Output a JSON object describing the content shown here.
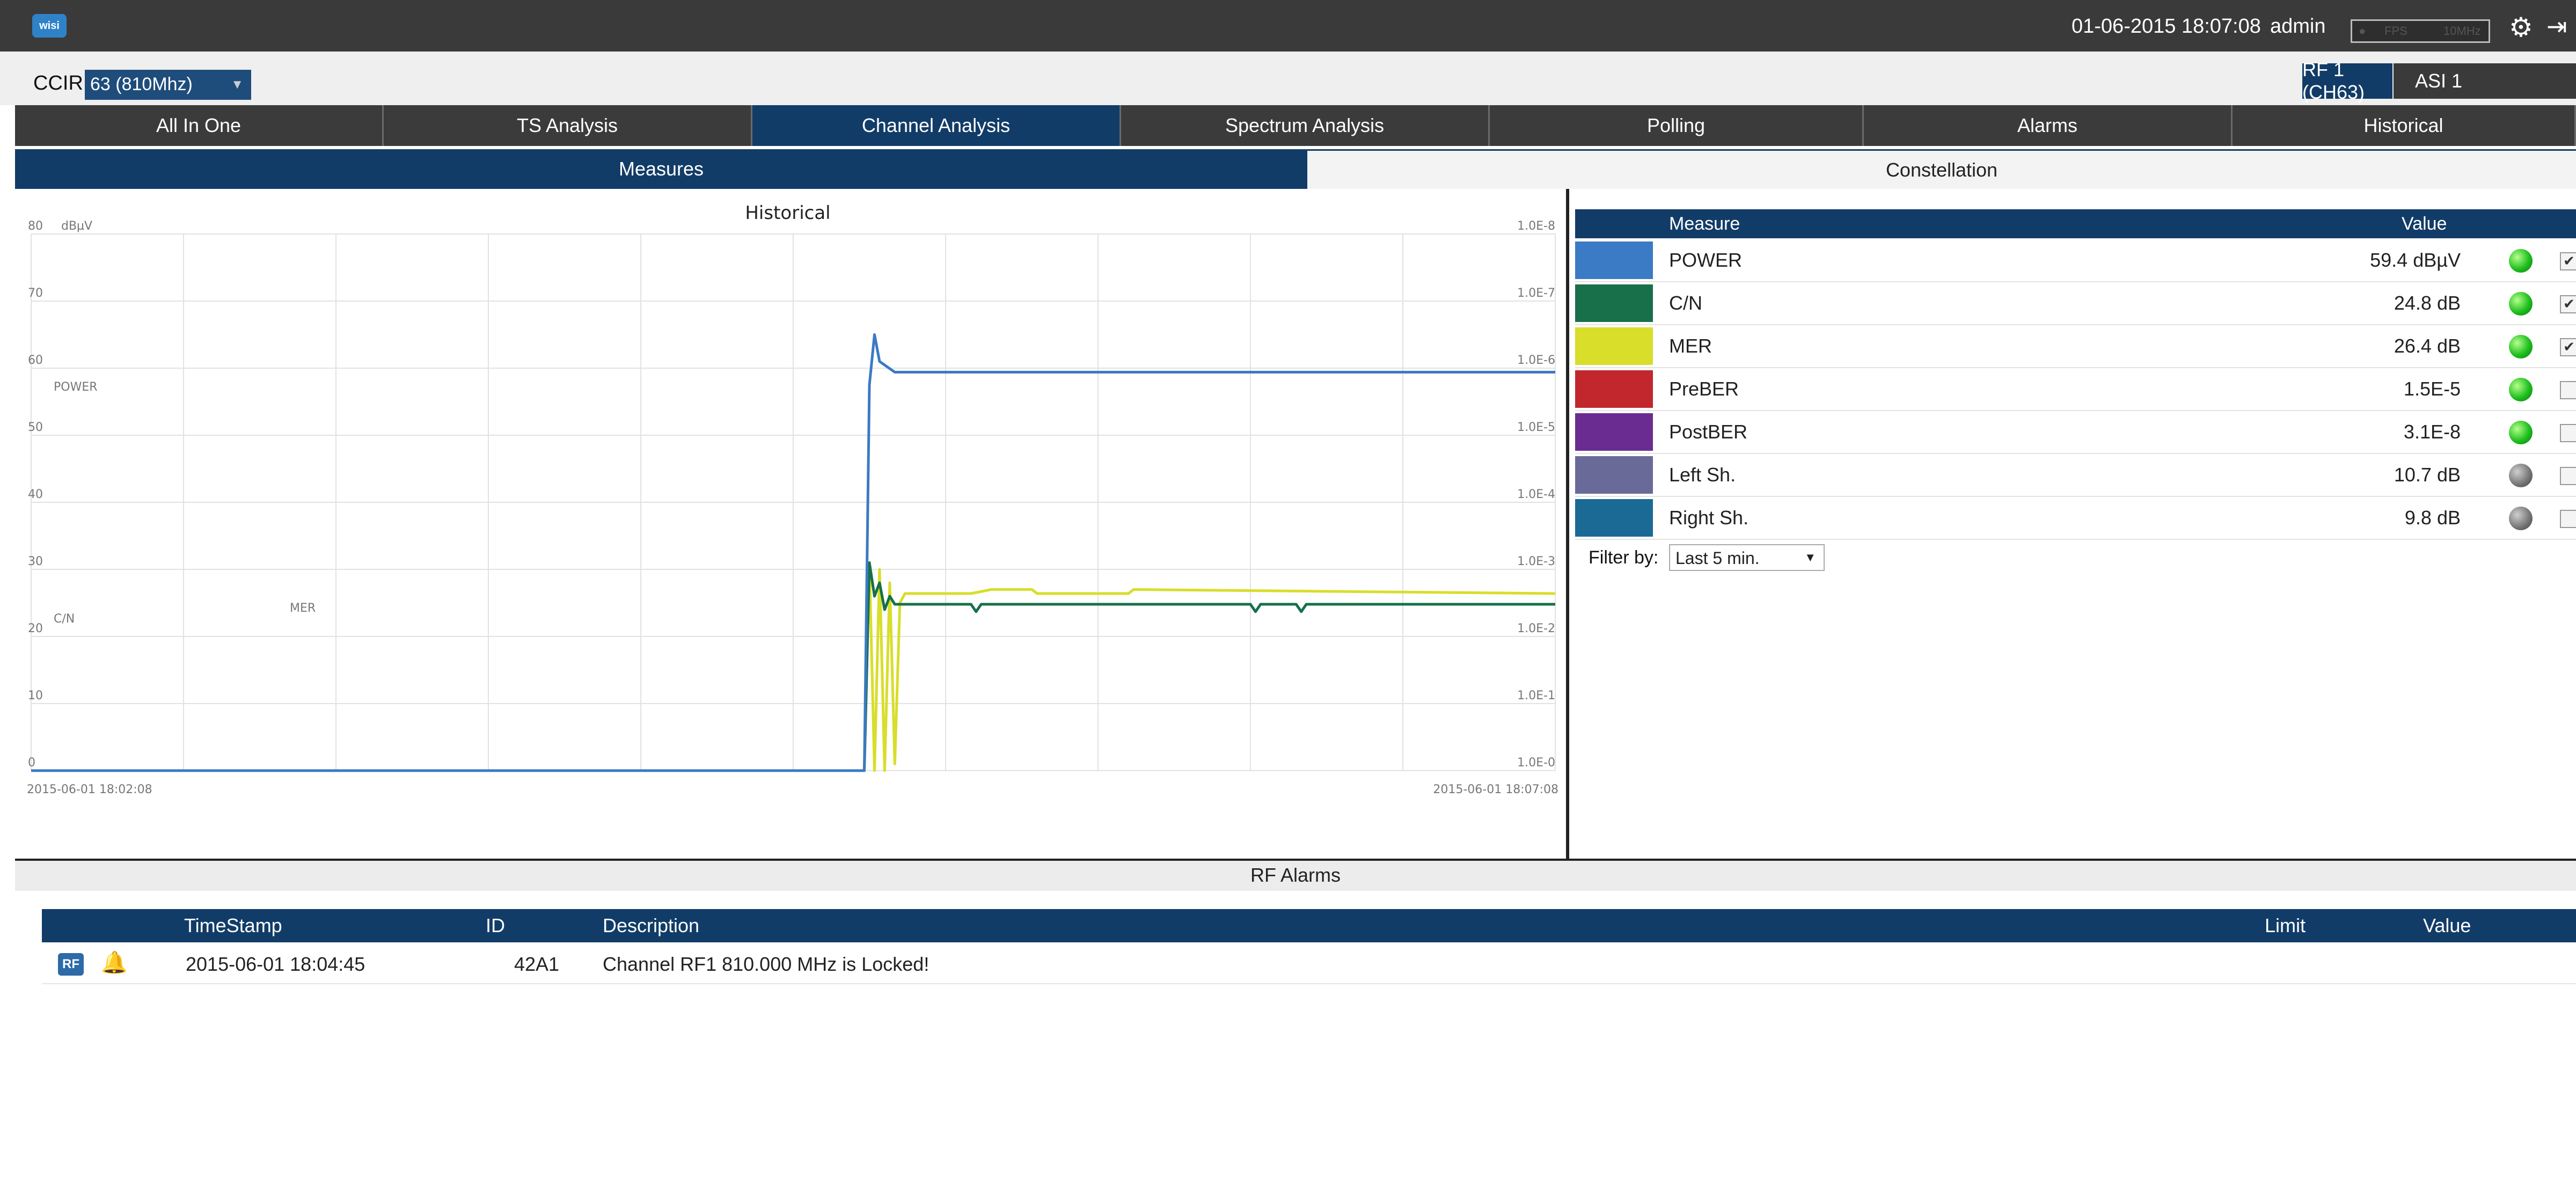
{
  "header": {
    "logo_text": "wisi",
    "datetime": "01-06-2015 18:07:08",
    "user": "admin",
    "meter_left": "FPS",
    "meter_right": "10MHz"
  },
  "subbar": {
    "ccir_label": "CCIR",
    "ccir_value": "63 (810Mhz)",
    "rf_badge": "RF 1 (CH63)",
    "asi_badge": "ASI 1"
  },
  "nav_tabs": [
    {
      "label": "All In One"
    },
    {
      "label": "TS Analysis"
    },
    {
      "label": "Channel Analysis",
      "active": true
    },
    {
      "label": "Spectrum Analysis"
    },
    {
      "label": "Polling"
    },
    {
      "label": "Alarms"
    },
    {
      "label": "Historical"
    }
  ],
  "sub_tabs": [
    {
      "label": "Measures",
      "active": true
    },
    {
      "label": "Constellation"
    }
  ],
  "chart_data": {
    "type": "line",
    "title": "Historical",
    "ylabel": "dBµV",
    "ylim": [
      0,
      80
    ],
    "y_ticks": [
      "80",
      "70",
      "60",
      "50",
      "40",
      "30",
      "20",
      "10",
      "0"
    ],
    "y2_ticks": [
      "1.0E-8",
      "1.0E-7",
      "1.0E-6",
      "1.0E-5",
      "1.0E-4",
      "1.0E-3",
      "1.0E-2",
      "1.0E-1",
      "1.0E-0"
    ],
    "x_start_label": "2015-06-01 18:02:08",
    "x_end_label": "2015-06-01 18:07:08",
    "xlim": [
      0,
      300
    ],
    "grid": true,
    "inline_labels": [
      "POWER",
      "C/N",
      "MER"
    ],
    "series": [
      {
        "name": "POWER",
        "color": "#3b7ac4",
        "x": [
          0,
          164,
          165,
          166,
          167,
          170,
          300
        ],
        "y": [
          0,
          0,
          57.5,
          65,
          61,
          59.4,
          59.4
        ]
      },
      {
        "name": "C/N",
        "color": "#17704a",
        "x": [
          0,
          164,
          165,
          166,
          167,
          168,
          169,
          170,
          180,
          185,
          186,
          187,
          240,
          241,
          242,
          249,
          250,
          251,
          300
        ],
        "y": [
          0,
          0,
          31,
          26,
          28,
          24,
          26,
          24.8,
          24.8,
          24.8,
          23.7,
          24.8,
          24.8,
          23.7,
          24.8,
          24.8,
          23.7,
          24.8,
          24.8
        ]
      },
      {
        "name": "MER",
        "color": "#d8de2a",
        "x": [
          0,
          164,
          165,
          166,
          167,
          168,
          169,
          170,
          171,
          172,
          185,
          189,
          197,
          198,
          201,
          216,
          217,
          300
        ],
        "y": [
          0,
          0,
          31,
          0,
          30,
          0,
          28,
          1,
          25,
          26.4,
          26.4,
          27,
          27,
          26.4,
          26.4,
          26.4,
          27,
          26.4
        ]
      }
    ]
  },
  "measures": {
    "col_measure": "Measure",
    "col_value": "Value",
    "rows": [
      {
        "name": "POWER",
        "value": "59.4 dBµV",
        "color": "#3b7ac4",
        "status": "green",
        "checked": true
      },
      {
        "name": "C/N",
        "value": "24.8 dB",
        "color": "#17704a",
        "status": "green",
        "checked": true
      },
      {
        "name": "MER",
        "value": "26.4 dB",
        "color": "#d8de2a",
        "status": "green",
        "checked": true
      },
      {
        "name": "PreBER",
        "value": "1.5E-5",
        "color": "#c1272d",
        "status": "green",
        "checked": false
      },
      {
        "name": "PostBER",
        "value": "3.1E-8",
        "color": "#6a2c91",
        "status": "green",
        "checked": false
      },
      {
        "name": "Left Sh.",
        "value": "10.7 dB",
        "color": "#6a6a98",
        "status": "gray",
        "checked": false
      },
      {
        "name": "Right Sh.",
        "value": "9.8 dB",
        "color": "#1b6a96",
        "status": "gray",
        "checked": false
      }
    ],
    "filter_label": "Filter by:",
    "filter_value": "Last 5 min."
  },
  "alarms": {
    "section_title": "RF Alarms",
    "columns": {
      "timestamp": "TimeStamp",
      "id": "ID",
      "description": "Description",
      "limit": "Limit",
      "value": "Value"
    },
    "rows": [
      {
        "badge": "RF",
        "timestamp": "2015-06-01 18:04:45",
        "id": "42A1",
        "description": "Channel RF1 810.000 MHz is Locked!",
        "limit": "",
        "value": ""
      }
    ]
  }
}
